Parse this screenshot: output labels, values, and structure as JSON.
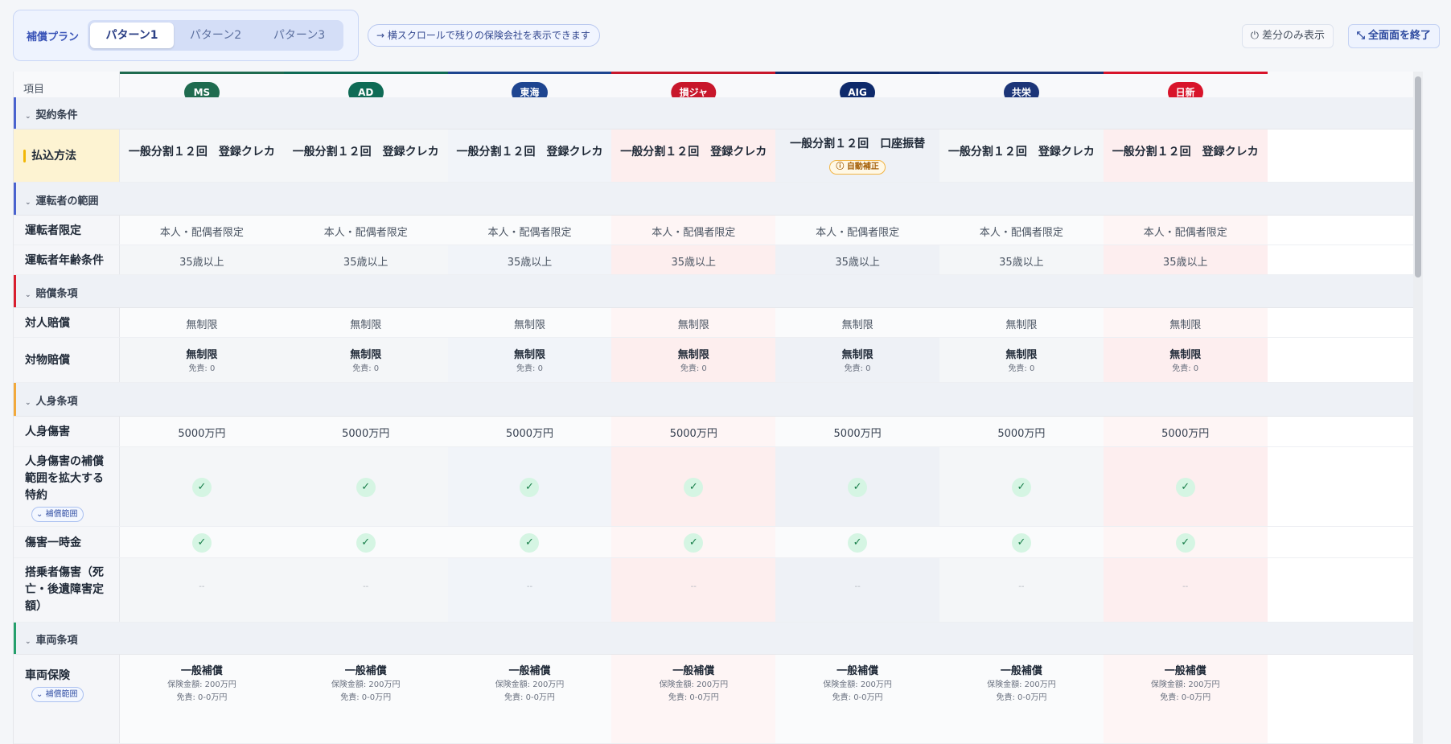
{
  "toolbar": {
    "plan_label": "補償プラン",
    "patterns": [
      "パターン1",
      "パターン2",
      "パターン3"
    ],
    "active_pattern": "パターン1",
    "scroll_hint": "→ 横スクロールで残りの保険会社を表示できます",
    "diff_only": "差分のみ表示",
    "exit_fullscreen": "全面面を終了"
  },
  "table": {
    "item_header": "項目",
    "companies": [
      {
        "name": "MS",
        "color": "#1f6b4f",
        "tint": "#f4f6f8"
      },
      {
        "name": "AD",
        "color": "#0f6b55",
        "tint": "#f4f6f8"
      },
      {
        "name": "東海",
        "color": "#1e4590",
        "tint": "#f1f4f9"
      },
      {
        "name": "損ジャ",
        "color": "#c8172b",
        "tint": "#fdeeee"
      },
      {
        "name": "AIG",
        "color": "#0e2a6b",
        "tint": "#eef1f6"
      },
      {
        "name": "共栄",
        "color": "#1c3578",
        "tint": "#f4f6f8"
      },
      {
        "name": "日新",
        "color": "#d8142a",
        "tint": "#fdeeef"
      }
    ],
    "sections": {
      "contract": "契約条件",
      "driver": "運転者の範囲",
      "liability": "賠償条項",
      "personal": "人身条項",
      "vehicle": "車両条項"
    },
    "rows": {
      "payment": {
        "label": "払込方法",
        "values": [
          "一般分割１２回　登録クレカ",
          "一般分割１２回　登録クレカ",
          "一般分割１２回　登録クレカ",
          "一般分割１２回　登録クレカ",
          "一般分割１２回　口座振替",
          "一般分割１２回　登録クレカ",
          "一般分割１２回　登録クレカ"
        ],
        "auto_fix": "自動補正"
      },
      "driver_limit": {
        "label": "運転者限定",
        "values": [
          "本人・配偶者限定",
          "本人・配偶者限定",
          "本人・配偶者限定",
          "本人・配偶者限定",
          "本人・配偶者限定",
          "本人・配偶者限定",
          "本人・配偶者限定"
        ]
      },
      "driver_age": {
        "label": "運転者年齢条件",
        "values": [
          "35歳以上",
          "35歳以上",
          "35歳以上",
          "35歳以上",
          "35歳以上",
          "35歳以上",
          "35歳以上"
        ]
      },
      "bodily": {
        "label": "対人賠償",
        "values": [
          "無制限",
          "無制限",
          "無制限",
          "無制限",
          "無制限",
          "無制限",
          "無制限"
        ]
      },
      "property": {
        "label": "対物賠償",
        "values": [
          "無制限",
          "無制限",
          "無制限",
          "無制限",
          "無制限",
          "無制限",
          "無制限"
        ],
        "sub": "免責: 0"
      },
      "injury": {
        "label": "人身傷害",
        "values": [
          "5000万円",
          "5000万円",
          "5000万円",
          "5000万円",
          "5000万円",
          "5000万円",
          "5000万円"
        ]
      },
      "injury_ext": {
        "label": "人身傷害の補償範囲を拡大する特約",
        "tag": "補償範囲"
      },
      "lump_sum": {
        "label": "傷害一時金"
      },
      "passenger": {
        "label": "搭乗者傷害（死亡・後遺障害定額）",
        "value": "--"
      },
      "vehicle_ins": {
        "label": "車両保険",
        "tag": "補償範囲",
        "value": "一般補償",
        "amount": "保険金額: 200万円",
        "deduct": "免責: 0-0万円"
      }
    }
  },
  "colors": {
    "accent": "#3b55b8",
    "check_bg": "#d5f5e3",
    "check_fg": "#1a7f4b"
  }
}
